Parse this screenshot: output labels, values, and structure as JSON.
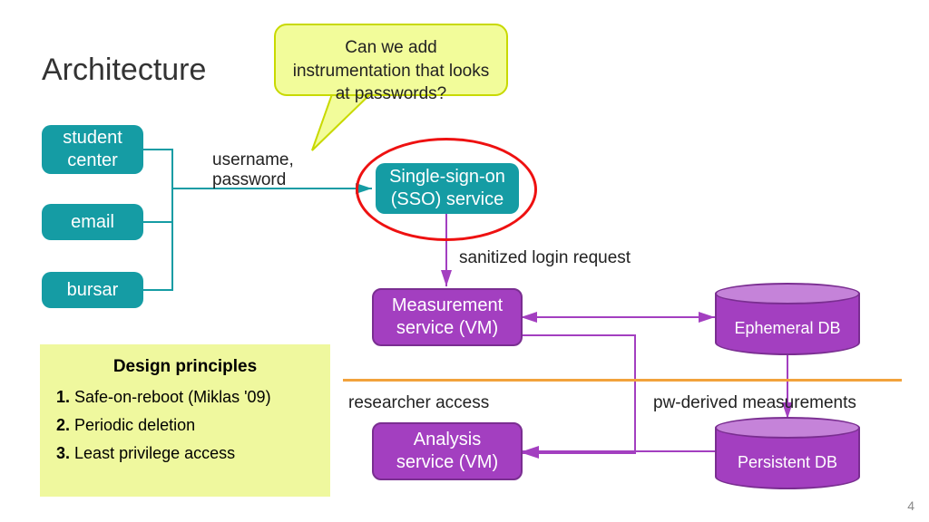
{
  "title": "Architecture",
  "callout": "Can we add instrumentation that looks at passwords?",
  "clients": {
    "student_center": "student center",
    "email": "email",
    "bursar": "bursar"
  },
  "sso": {
    "line1": "Single-sign-on",
    "line2": "(SSO) service"
  },
  "measurement": {
    "line1": "Measurement",
    "line2": "service (VM)"
  },
  "analysis": {
    "line1": "Analysis",
    "line2": "service (VM)"
  },
  "db": {
    "ephemeral": "Ephemeral DB",
    "persistent": "Persistent DB"
  },
  "labels": {
    "credentials_line1": "username,",
    "credentials_line2": "password",
    "sanitized": "sanitized login request",
    "researcher": "researcher access",
    "pwderived": "pw-derived measurements"
  },
  "principles": {
    "title": "Design principles",
    "items": [
      {
        "num": "1.",
        "text": "Safe-on-reboot (Miklas '09)"
      },
      {
        "num": "2.",
        "text": "Periodic deletion"
      },
      {
        "num": "3.",
        "text": "Least privilege access"
      }
    ]
  },
  "page_number": "4"
}
